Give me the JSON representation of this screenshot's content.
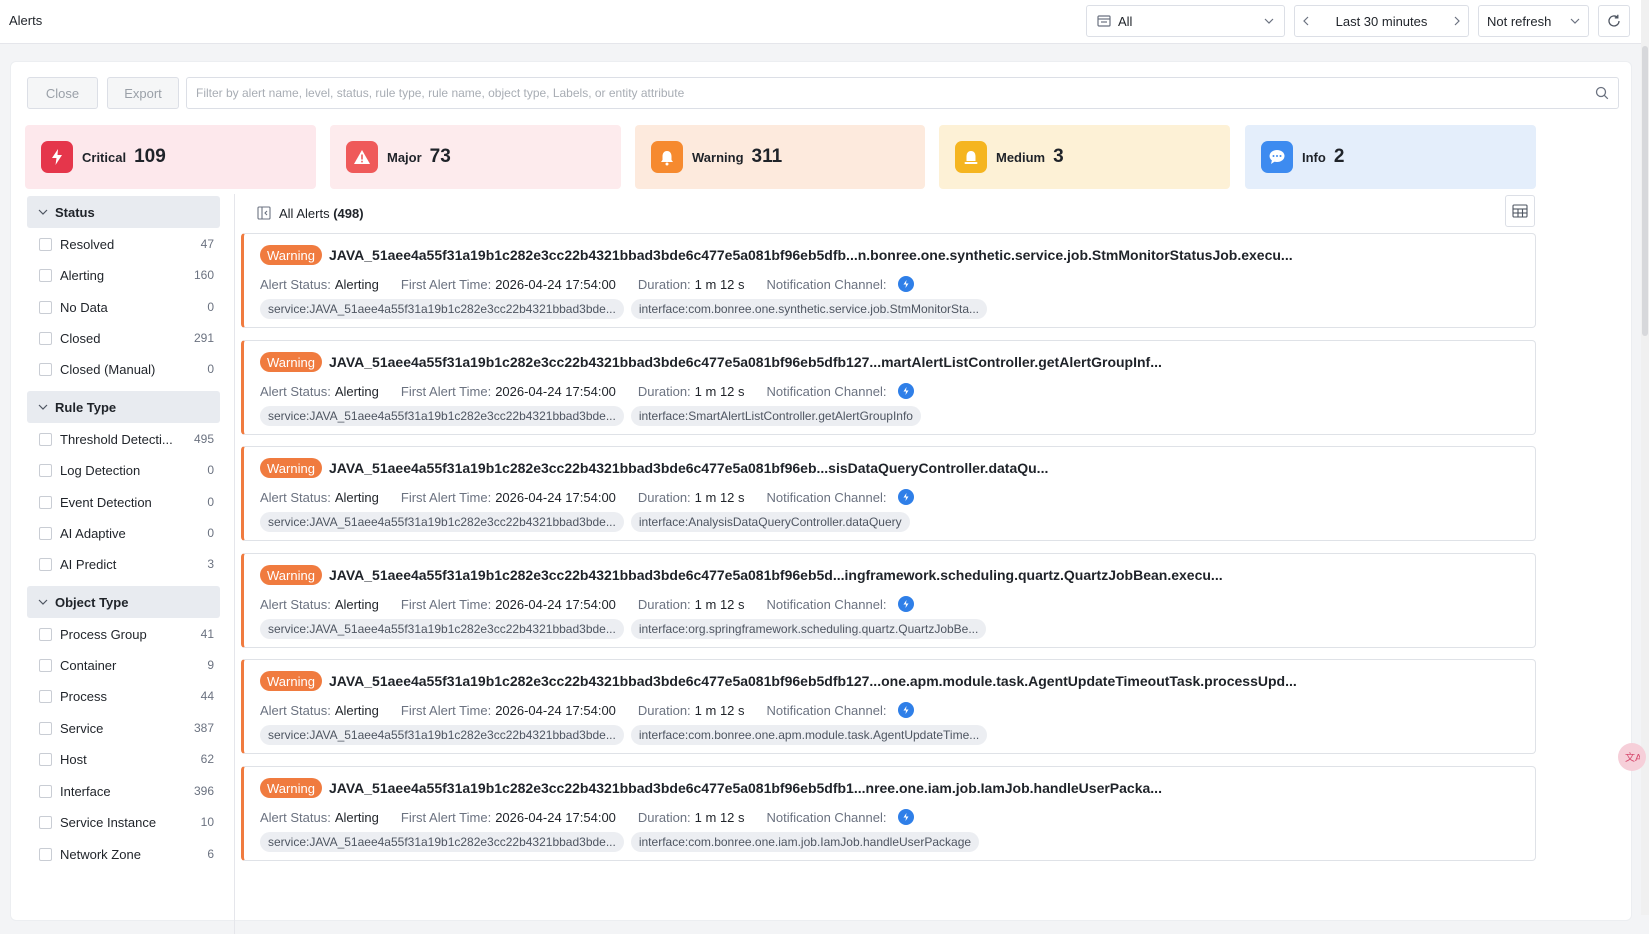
{
  "header": {
    "title": "Alerts",
    "scope_label": "All",
    "time_range": "Last 30 minutes",
    "refresh_label": "Not refresh"
  },
  "toolbar": {
    "close_label": "Close",
    "export_label": "Export",
    "filter_placeholder": "Filter by alert name, level, status, rule type, rule name, object type, Labels, or entity attribute"
  },
  "levels": [
    {
      "name": "Critical",
      "count": "109",
      "bg": "#fde8ec",
      "icon_bg": "#e5364b",
      "icon": "lightning-icon"
    },
    {
      "name": "Major",
      "count": "73",
      "bg": "#fdebed",
      "icon_bg": "#ef5a5a",
      "icon": "warning-triangle-icon"
    },
    {
      "name": "Warning",
      "count": "311",
      "bg": "#fdeadd",
      "icon_bg": "#f68a2f",
      "icon": "bell-icon"
    },
    {
      "name": "Medium",
      "count": "3",
      "bg": "#fdf1d6",
      "icon_bg": "#f5b520",
      "icon": "bell-ring-icon"
    },
    {
      "name": "Info",
      "count": "2",
      "bg": "#e4eefb",
      "icon_bg": "#3d8bf0",
      "icon": "chat-bubble-icon"
    }
  ],
  "filters": {
    "status": {
      "title": "Status",
      "items": [
        {
          "label": "Resolved",
          "count": "47"
        },
        {
          "label": "Alerting",
          "count": "160"
        },
        {
          "label": "No Data",
          "count": "0"
        },
        {
          "label": "Closed",
          "count": "291"
        },
        {
          "label": "Closed (Manual)",
          "count": "0"
        }
      ]
    },
    "rule_type": {
      "title": "Rule Type",
      "items": [
        {
          "label": "Threshold Detecti...",
          "count": "495"
        },
        {
          "label": "Log Detection",
          "count": "0"
        },
        {
          "label": "Event Detection",
          "count": "0"
        },
        {
          "label": "AI Adaptive",
          "count": "0"
        },
        {
          "label": "AI Predict",
          "count": "3"
        }
      ]
    },
    "object_type": {
      "title": "Object Type",
      "items": [
        {
          "label": "Process Group",
          "count": "41"
        },
        {
          "label": "Container",
          "count": "9"
        },
        {
          "label": "Process",
          "count": "44"
        },
        {
          "label": "Service",
          "count": "387"
        },
        {
          "label": "Host",
          "count": "62"
        },
        {
          "label": "Interface",
          "count": "396"
        },
        {
          "label": "Service Instance",
          "count": "10"
        },
        {
          "label": "Network Zone",
          "count": "6"
        }
      ]
    }
  },
  "list": {
    "heading": "All Alerts",
    "count": "(498)"
  },
  "alert_labels": {
    "status_key": "Alert Status:",
    "first_time_key": "First Alert Time:",
    "duration_key": "Duration:",
    "channel_key": "Notification Channel:"
  },
  "alerts": [
    {
      "level": "Warning",
      "title": "JAVA_51aee4a55f31a19b1c282e3cc22b4321bbad3bde6c477e5a081bf96eb5dfb...n.bonree.one.synthetic.service.job.StmMonitorStatusJob.execu...",
      "status": "Alerting",
      "first_time": "2026-04-24 17:54:00",
      "duration": "1 m 12 s",
      "tags": [
        "service:JAVA_51aee4a55f31a19b1c282e3cc22b4321bbad3bde...",
        "interface:com.bonree.one.synthetic.service.job.StmMonitorSta..."
      ]
    },
    {
      "level": "Warning",
      "title": "JAVA_51aee4a55f31a19b1c282e3cc22b4321bbad3bde6c477e5a081bf96eb5dfb127...martAlertListController.getAlertGroupInf...",
      "status": "Alerting",
      "first_time": "2026-04-24 17:54:00",
      "duration": "1 m 12 s",
      "tags": [
        "service:JAVA_51aee4a55f31a19b1c282e3cc22b4321bbad3bde...",
        "interface:SmartAlertListController.getAlertGroupInfo"
      ]
    },
    {
      "level": "Warning",
      "title": "JAVA_51aee4a55f31a19b1c282e3cc22b4321bbad3bde6c477e5a081bf96eb...sisDataQueryController.dataQu...",
      "status": "Alerting",
      "first_time": "2026-04-24 17:54:00",
      "duration": "1 m 12 s",
      "tags": [
        "service:JAVA_51aee4a55f31a19b1c282e3cc22b4321bbad3bde...",
        "interface:AnalysisDataQueryController.dataQuery"
      ]
    },
    {
      "level": "Warning",
      "title": "JAVA_51aee4a55f31a19b1c282e3cc22b4321bbad3bde6c477e5a081bf96eb5d...ingframework.scheduling.quartz.QuartzJobBean.execu...",
      "status": "Alerting",
      "first_time": "2026-04-24 17:54:00",
      "duration": "1 m 12 s",
      "tags": [
        "service:JAVA_51aee4a55f31a19b1c282e3cc22b4321bbad3bde...",
        "interface:org.springframework.scheduling.quartz.QuartzJobBe..."
      ]
    },
    {
      "level": "Warning",
      "title": "JAVA_51aee4a55f31a19b1c282e3cc22b4321bbad3bde6c477e5a081bf96eb5dfb127...one.apm.module.task.AgentUpdateTimeoutTask.processUpd...",
      "status": "Alerting",
      "first_time": "2026-04-24 17:54:00",
      "duration": "1 m 12 s",
      "tags": [
        "service:JAVA_51aee4a55f31a19b1c282e3cc22b4321bbad3bde...",
        "interface:com.bonree.one.apm.module.task.AgentUpdateTime..."
      ]
    },
    {
      "level": "Warning",
      "title": "JAVA_51aee4a55f31a19b1c282e3cc22b4321bbad3bde6c477e5a081bf96eb5dfb1...nree.one.iam.job.IamJob.handleUserPacka...",
      "status": "Alerting",
      "first_time": "2026-04-24 17:54:00",
      "duration": "1 m 12 s",
      "tags": [
        "service:JAVA_51aee4a55f31a19b1c282e3cc22b4321bbad3bde...",
        "interface:com.bonree.one.iam.job.IamJob.handleUserPackage"
      ]
    }
  ]
}
